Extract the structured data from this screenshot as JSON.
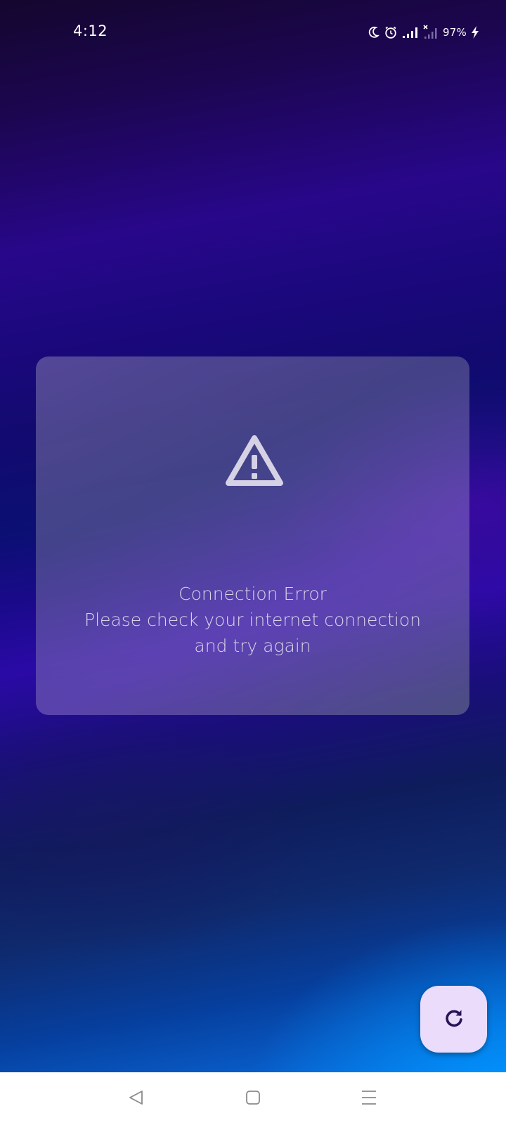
{
  "status_bar": {
    "time": "4:12",
    "battery_percent": "97%",
    "icons": [
      "moon-icon",
      "alarm-icon",
      "signal-icon",
      "no-signal-icon",
      "battery-charging-icon"
    ]
  },
  "error_card": {
    "icon": "warning-icon",
    "title": "Connection Error",
    "message_line1": "Please check your internet connection",
    "message_line2": "and try again"
  },
  "fab": {
    "icon": "refresh-icon",
    "background": "#ebdcfb"
  },
  "nav_bar": {
    "items": [
      "back-icon",
      "home-icon",
      "recents-icon"
    ]
  },
  "colors": {
    "card_text": "#d9d4ea",
    "icon_color": "#2a1456"
  }
}
